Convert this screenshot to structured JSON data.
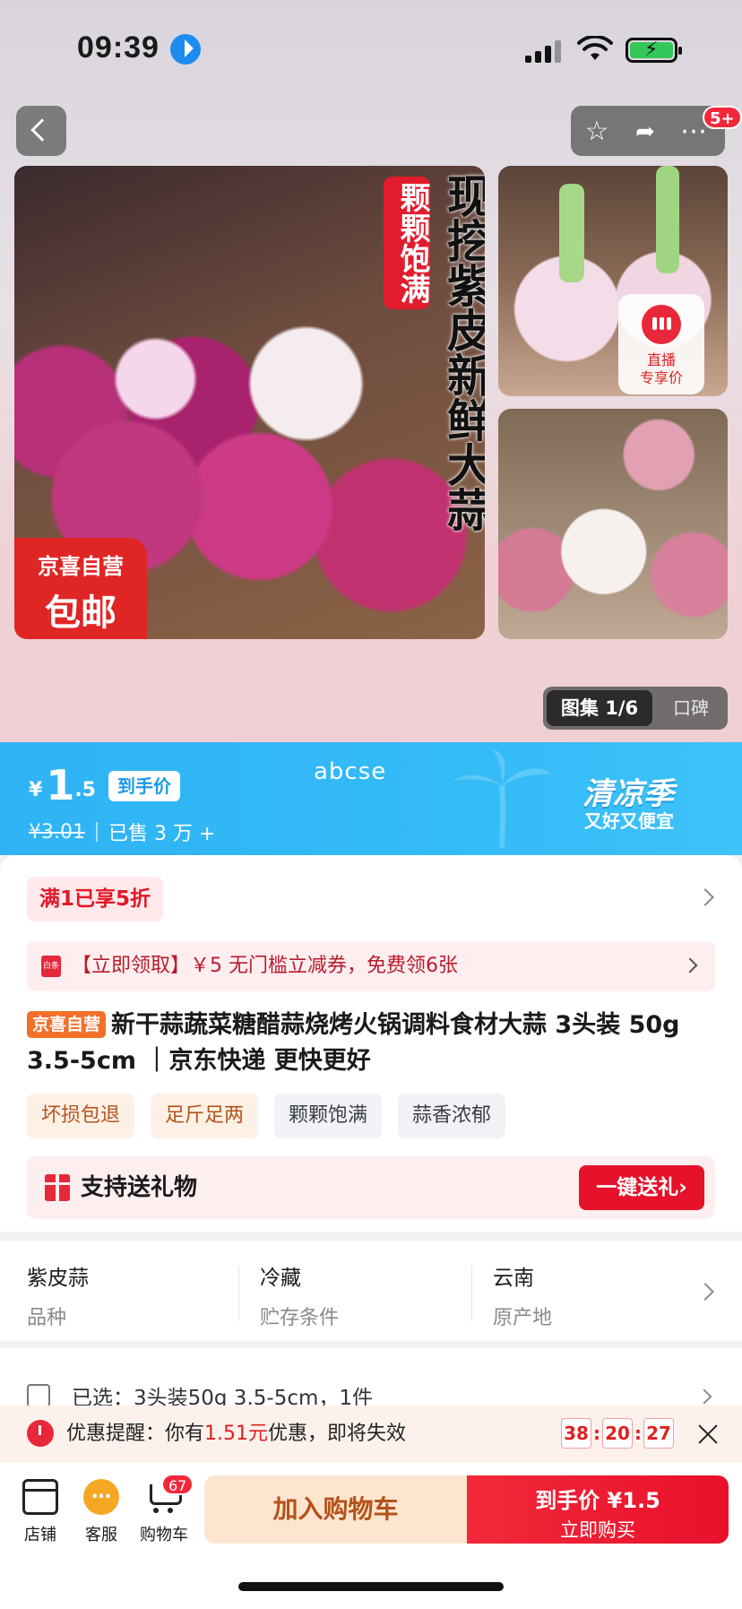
{
  "status_bar": {
    "time": "09:39"
  },
  "header": {
    "more_badge": "5+"
  },
  "hero": {
    "vertical_title": "现挖紫皮新鲜大蒜",
    "vertical_tag": "颗颗饱满",
    "corner_line1": "京喜自营",
    "corner_line2": "包邮",
    "live_label_1": "直播",
    "live_label_2": "专享价",
    "gallery_label": "图集 1/6",
    "review_label": "口碑"
  },
  "price_banner": {
    "currency": "¥",
    "price_int": "1",
    "price_dec": ".5",
    "hand_price_tag": "到手价",
    "old_price": "¥3.01",
    "sold": "已售 3 万 +",
    "center_text": "abcse",
    "title": "清凉季",
    "subtitle": "又好又便宜"
  },
  "promo": {
    "chip": "满1已享5折",
    "coupon_icon": "白条",
    "coupon_text": "【立即领取】￥5 无门槛立减券，免费领6张"
  },
  "product": {
    "self_tag": "京喜自营",
    "title": "新干蒜蔬菜糖醋蒜烧烤火锅调料食材大蒜 3头装 50g 3.5-5cm ｜京东快递 更快更好",
    "tags": [
      "坏损包退",
      "足斤足两",
      "颗颗饱满",
      "蒜香浓郁"
    ]
  },
  "gift": {
    "text": "支持送礼物",
    "button": "一键送礼›"
  },
  "attributes": [
    {
      "value": "紫皮蒜",
      "key": "品种"
    },
    {
      "value": "冷藏",
      "key": "贮存条件"
    },
    {
      "value": "云南",
      "key": "原产地"
    }
  ],
  "selection": {
    "text": "已选：3头装50g 3.5-5cm，1件"
  },
  "reminder": {
    "prefix": "优惠提醒：你有",
    "amount": "1.51元",
    "suffix": "优惠，即将失效",
    "hh": "38",
    "mm": "20",
    "ss": "27"
  },
  "bottom_bar": {
    "shop": "店铺",
    "service": "客服",
    "cart": "购物车",
    "cart_badge": "67",
    "add_to_cart": "加入购物车",
    "buy_line1": "到手价 ¥1.5",
    "buy_line2": "立即购买"
  },
  "colors": {
    "accent_red": "#e6112a",
    "banner_blue": "#33bbf7",
    "warm_tag": "#fdf1e6"
  }
}
